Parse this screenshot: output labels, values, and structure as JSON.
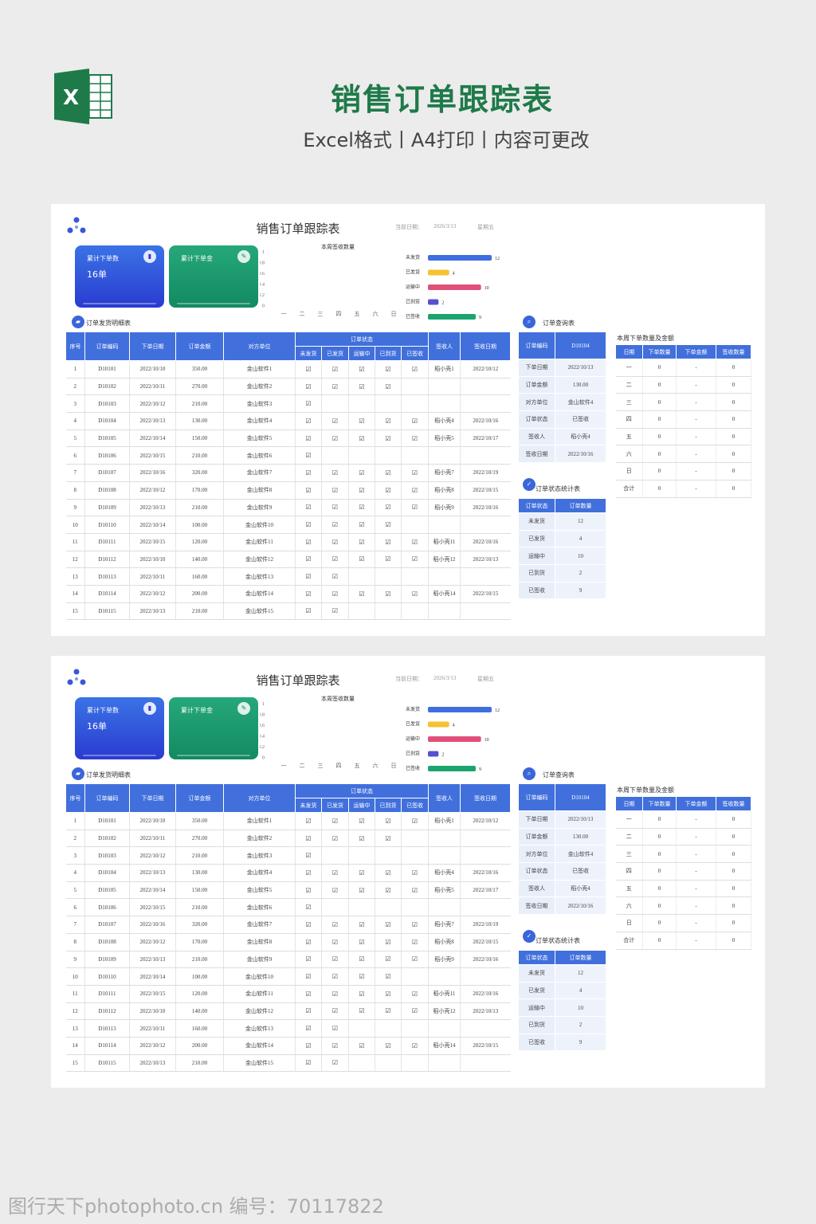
{
  "header": {
    "title": "销售订单跟踪表",
    "subtitle": "Excel格式丨A4打印丨内容可更改"
  },
  "sheet": {
    "title": "销售订单跟踪表",
    "date_label": "当前日期：",
    "date_value": "2026/3/13",
    "weekday": "星期五",
    "card_orders": {
      "label": "累计下单数",
      "value": "16单"
    },
    "card_amount": {
      "label": "累计下单金",
      "value": ""
    },
    "week_chart": {
      "title": "本周签收数量",
      "yticks": [
        "1",
        "0.8",
        "0.6",
        "0.4",
        "0.2",
        "0"
      ],
      "days": [
        "一",
        "二",
        "三",
        "四",
        "五",
        "六",
        "日"
      ]
    },
    "detail_label": "订单发货明细表",
    "query_label": "订单查询表",
    "status_label": "订单状态统计表",
    "week_label": "本周下单数量及金额",
    "columns": {
      "no": "序号",
      "code": "订单编码",
      "date": "下单日期",
      "amount": "金额",
      "amount_full": "订单金额",
      "party": "对方单位",
      "status": "订单状态",
      "receiver": "签收人",
      "sign_date": "签收日期",
      "s1": "未发货",
      "s2": "已发货",
      "s3": "运输中",
      "s4": "已到货",
      "s5": "已签收"
    },
    "rows": [
      {
        "no": "1",
        "code": "D10101",
        "date": "2022/10/10",
        "amount": "350.00",
        "party": "金山软件1",
        "s": [
          1,
          1,
          1,
          1,
          1
        ],
        "rcv": "稻小壳1",
        "sdate": "2022/10/12"
      },
      {
        "no": "2",
        "code": "D10102",
        "date": "2022/10/11",
        "amount": "270.00",
        "party": "金山软件2",
        "s": [
          1,
          1,
          1,
          1,
          0
        ],
        "rcv": "",
        "sdate": ""
      },
      {
        "no": "3",
        "code": "D10103",
        "date": "2022/10/12",
        "amount": "210.00",
        "party": "金山软件3",
        "s": [
          1,
          0,
          0,
          0,
          0
        ],
        "rcv": "",
        "sdate": ""
      },
      {
        "no": "4",
        "code": "D10104",
        "date": "2022/10/13",
        "amount": "130.00",
        "party": "金山软件4",
        "s": [
          1,
          1,
          1,
          1,
          1
        ],
        "rcv": "稻小壳4",
        "sdate": "2022/10/16"
      },
      {
        "no": "5",
        "code": "D10105",
        "date": "2022/10/14",
        "amount": "150.00",
        "party": "金山软件5",
        "s": [
          1,
          1,
          1,
          1,
          1
        ],
        "rcv": "稻小壳5",
        "sdate": "2022/10/17"
      },
      {
        "no": "6",
        "code": "D10106",
        "date": "2022/10/15",
        "amount": "210.00",
        "party": "金山软件6",
        "s": [
          1,
          0,
          0,
          0,
          0
        ],
        "rcv": "",
        "sdate": ""
      },
      {
        "no": "7",
        "code": "D10107",
        "date": "2022/10/16",
        "amount": "320.00",
        "party": "金山软件7",
        "s": [
          1,
          1,
          1,
          1,
          1
        ],
        "rcv": "稻小壳7",
        "sdate": "2022/10/19"
      },
      {
        "no": "8",
        "code": "D10108",
        "date": "2022/10/12",
        "amount": "170.00",
        "party": "金山软件8",
        "s": [
          1,
          1,
          1,
          1,
          1
        ],
        "rcv": "稻小壳8",
        "sdate": "2022/10/15"
      },
      {
        "no": "9",
        "code": "D10109",
        "date": "2022/10/13",
        "amount": "210.00",
        "party": "金山软件9",
        "s": [
          1,
          1,
          1,
          1,
          1
        ],
        "rcv": "稻小壳9",
        "sdate": "2022/10/16"
      },
      {
        "no": "10",
        "code": "D10110",
        "date": "2022/10/14",
        "amount": "100.00",
        "party": "金山软件10",
        "s": [
          1,
          1,
          1,
          1,
          0
        ],
        "rcv": "",
        "sdate": ""
      },
      {
        "no": "11",
        "code": "D10111",
        "date": "2022/10/15",
        "amount": "120.00",
        "party": "金山软件11",
        "s": [
          1,
          1,
          1,
          1,
          1
        ],
        "rcv": "稻小壳11",
        "sdate": "2022/10/16"
      },
      {
        "no": "12",
        "code": "D10112",
        "date": "2022/10/10",
        "amount": "140.00",
        "party": "金山软件12",
        "s": [
          1,
          1,
          1,
          1,
          1
        ],
        "rcv": "稻小壳12",
        "sdate": "2022/10/13"
      },
      {
        "no": "13",
        "code": "D10113",
        "date": "2022/10/11",
        "amount": "160.00",
        "party": "金山软件13",
        "s": [
          1,
          1,
          0,
          0,
          0
        ],
        "rcv": "",
        "sdate": ""
      },
      {
        "no": "14",
        "code": "D10114",
        "date": "2022/10/12",
        "amount": "200.00",
        "party": "金山软件14",
        "s": [
          1,
          1,
          1,
          1,
          1
        ],
        "rcv": "稻小壳14",
        "sdate": "2022/10/15"
      },
      {
        "no": "15",
        "code": "D10115",
        "date": "2022/10/13",
        "amount": "210.00",
        "party": "金山软件15",
        "s": [
          1,
          1,
          0,
          0,
          0
        ],
        "rcv": "",
        "sdate": ""
      }
    ],
    "query": {
      "header": [
        "订单编码",
        "D10104"
      ],
      "rows": [
        [
          "下单日期",
          "2022/10/13"
        ],
        [
          "订单金额",
          "130.00"
        ],
        [
          "对方单位",
          "金山软件4"
        ],
        [
          "订单状态",
          "已签收"
        ],
        [
          "签收人",
          "稻小壳4"
        ],
        [
          "签收日期",
          "2022/10/16"
        ]
      ]
    },
    "status_stats": {
      "header": [
        "订单状态",
        "订单数量"
      ],
      "rows": [
        [
          "未发货",
          "12"
        ],
        [
          "已发货",
          "4"
        ],
        [
          "运输中",
          "10"
        ],
        [
          "已到货",
          "2"
        ],
        [
          "已签收",
          "9"
        ]
      ]
    },
    "week_table": {
      "header": [
        "日期",
        "下单数量",
        "下单金额",
        "签收数量"
      ],
      "rows": [
        [
          "一",
          "0",
          "-",
          "0"
        ],
        [
          "二",
          "0",
          "-",
          "0"
        ],
        [
          "三",
          "0",
          "-",
          "0"
        ],
        [
          "四",
          "0",
          "-",
          "0"
        ],
        [
          "五",
          "0",
          "-",
          "0"
        ],
        [
          "六",
          "0",
          "-",
          "0"
        ],
        [
          "日",
          "0",
          "-",
          "0"
        ],
        [
          "合计",
          "0",
          "-",
          "0"
        ]
      ]
    }
  },
  "chart_data": {
    "type": "bar",
    "categories": [
      "未发货",
      "已发货",
      "运输中",
      "已到货",
      "已签收"
    ],
    "values": [
      12,
      4,
      10,
      2,
      9
    ],
    "colors": [
      "#3f6ee0",
      "#f5c231",
      "#e0507a",
      "#5a4fd0",
      "#1aa56e"
    ],
    "title": "",
    "xlabel": "",
    "ylabel": ""
  },
  "footer": {
    "watermark": "图行天下photophoto.cn 编号：70117822"
  }
}
